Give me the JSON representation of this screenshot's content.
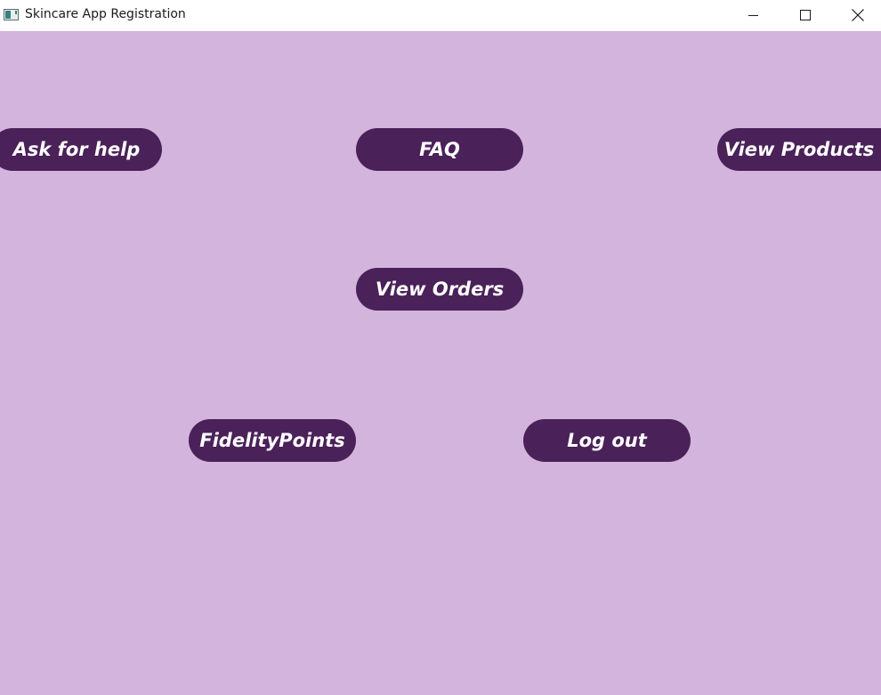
{
  "window": {
    "title": "Skincare App Registration",
    "controls": {
      "minimize": "minimize-icon",
      "maximize": "maximize-icon",
      "close": "close-icon"
    }
  },
  "colors": {
    "background": "#d3b4dd",
    "button": "#4a2159",
    "button_text": "#ffffff"
  },
  "buttons": {
    "ask_for_help": "Ask for help",
    "faq": "FAQ",
    "view_products": "View Products",
    "view_orders": "View Orders",
    "fidelity_points": "FidelityPoints",
    "log_out": "Log out"
  }
}
